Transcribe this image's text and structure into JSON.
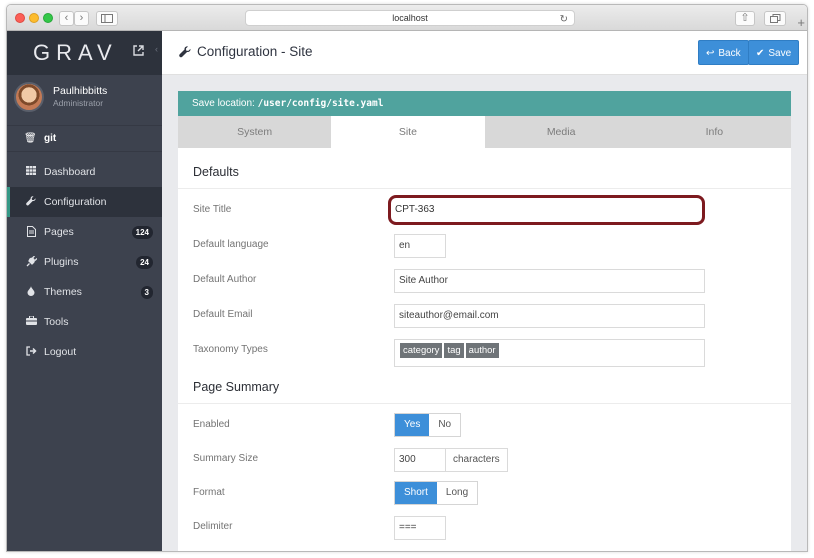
{
  "browser": {
    "url": "localhost"
  },
  "sidebar": {
    "logo": "GRAV",
    "user": {
      "name": "Paulhibbitts",
      "role": "Administrator"
    },
    "git": {
      "label": "git"
    },
    "items": [
      {
        "label": "Dashboard",
        "icon": "grid-icon"
      },
      {
        "label": "Configuration",
        "icon": "wrench-icon"
      },
      {
        "label": "Pages",
        "icon": "file-icon",
        "count": "124"
      },
      {
        "label": "Plugins",
        "icon": "plug-icon",
        "count": "24"
      },
      {
        "label": "Themes",
        "icon": "droplet-icon",
        "count": "3"
      },
      {
        "label": "Tools",
        "icon": "briefcase-icon"
      },
      {
        "label": "Logout",
        "icon": "sign-out-icon"
      }
    ]
  },
  "header": {
    "title": "Configuration - Site",
    "back_label": "Back",
    "save_label": "Save"
  },
  "save_location": {
    "label": "Save location:",
    "path": "/user/config/site.yaml"
  },
  "tabs": [
    "System",
    "Site",
    "Media",
    "Info"
  ],
  "defaults": {
    "heading": "Defaults",
    "site_title": {
      "label": "Site Title",
      "value": "CPT-363"
    },
    "language": {
      "label": "Default language",
      "value": "en"
    },
    "author": {
      "label": "Default Author",
      "value": "Site Author"
    },
    "email": {
      "label": "Default Email",
      "value": "siteauthor@email.com"
    },
    "taxonomy": {
      "label": "Taxonomy Types",
      "tags": [
        "category",
        "tag",
        "author"
      ]
    }
  },
  "summary": {
    "heading": "Page Summary",
    "enabled": {
      "label": "Enabled",
      "yes": "Yes",
      "no": "No"
    },
    "size": {
      "label": "Summary Size",
      "value": "300",
      "unit": "characters"
    },
    "format": {
      "label": "Format",
      "short": "Short",
      "long": "Long"
    },
    "delimiter": {
      "label": "Delimiter",
      "value": "==="
    }
  }
}
